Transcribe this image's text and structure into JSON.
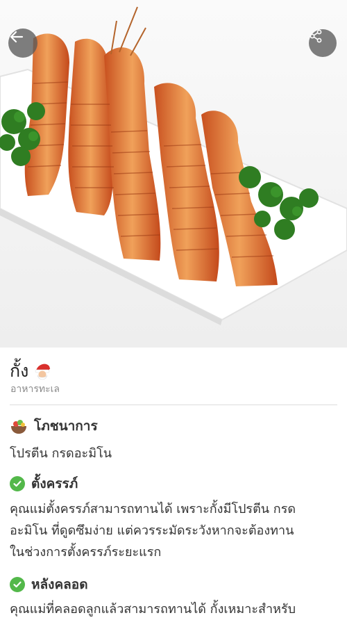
{
  "header": {
    "back_icon": "arrow-left-icon",
    "share_icon": "share-icon"
  },
  "food": {
    "name": "กั้ง",
    "badge_icon": "santa-icon",
    "category": "อาหารทะเล"
  },
  "sections": {
    "nutrition": {
      "icon": "bowl-icon",
      "title": "โภชนาการ",
      "text": "โปรตีน กรดอะมิโน"
    },
    "pregnant": {
      "icon": "check-circle-icon",
      "title": "ตั้งครรภ์",
      "text_lines": [
        "คุณแม่ตั้งครรภ์สามารถทานได้ เพราะกั้งมีโปรตีน กรด",
        "อะมิโน ที่ดูดซึมง่าย แต่ควรระมัดระวังหากจะต้องทาน",
        "ในช่วงการตั้งครรภ์ระยะแรก"
      ]
    },
    "postpartum": {
      "icon": "check-circle-icon",
      "title": "หลังคลอด",
      "text": "คุณแม่ที่คลอดลูกแล้วสามารถทานได้ กั้งเหมาะสำหรับ"
    }
  },
  "colors": {
    "check_green": "#53b84a",
    "divider": "#dcdcdc",
    "button_bg": "#5a5a5a"
  }
}
